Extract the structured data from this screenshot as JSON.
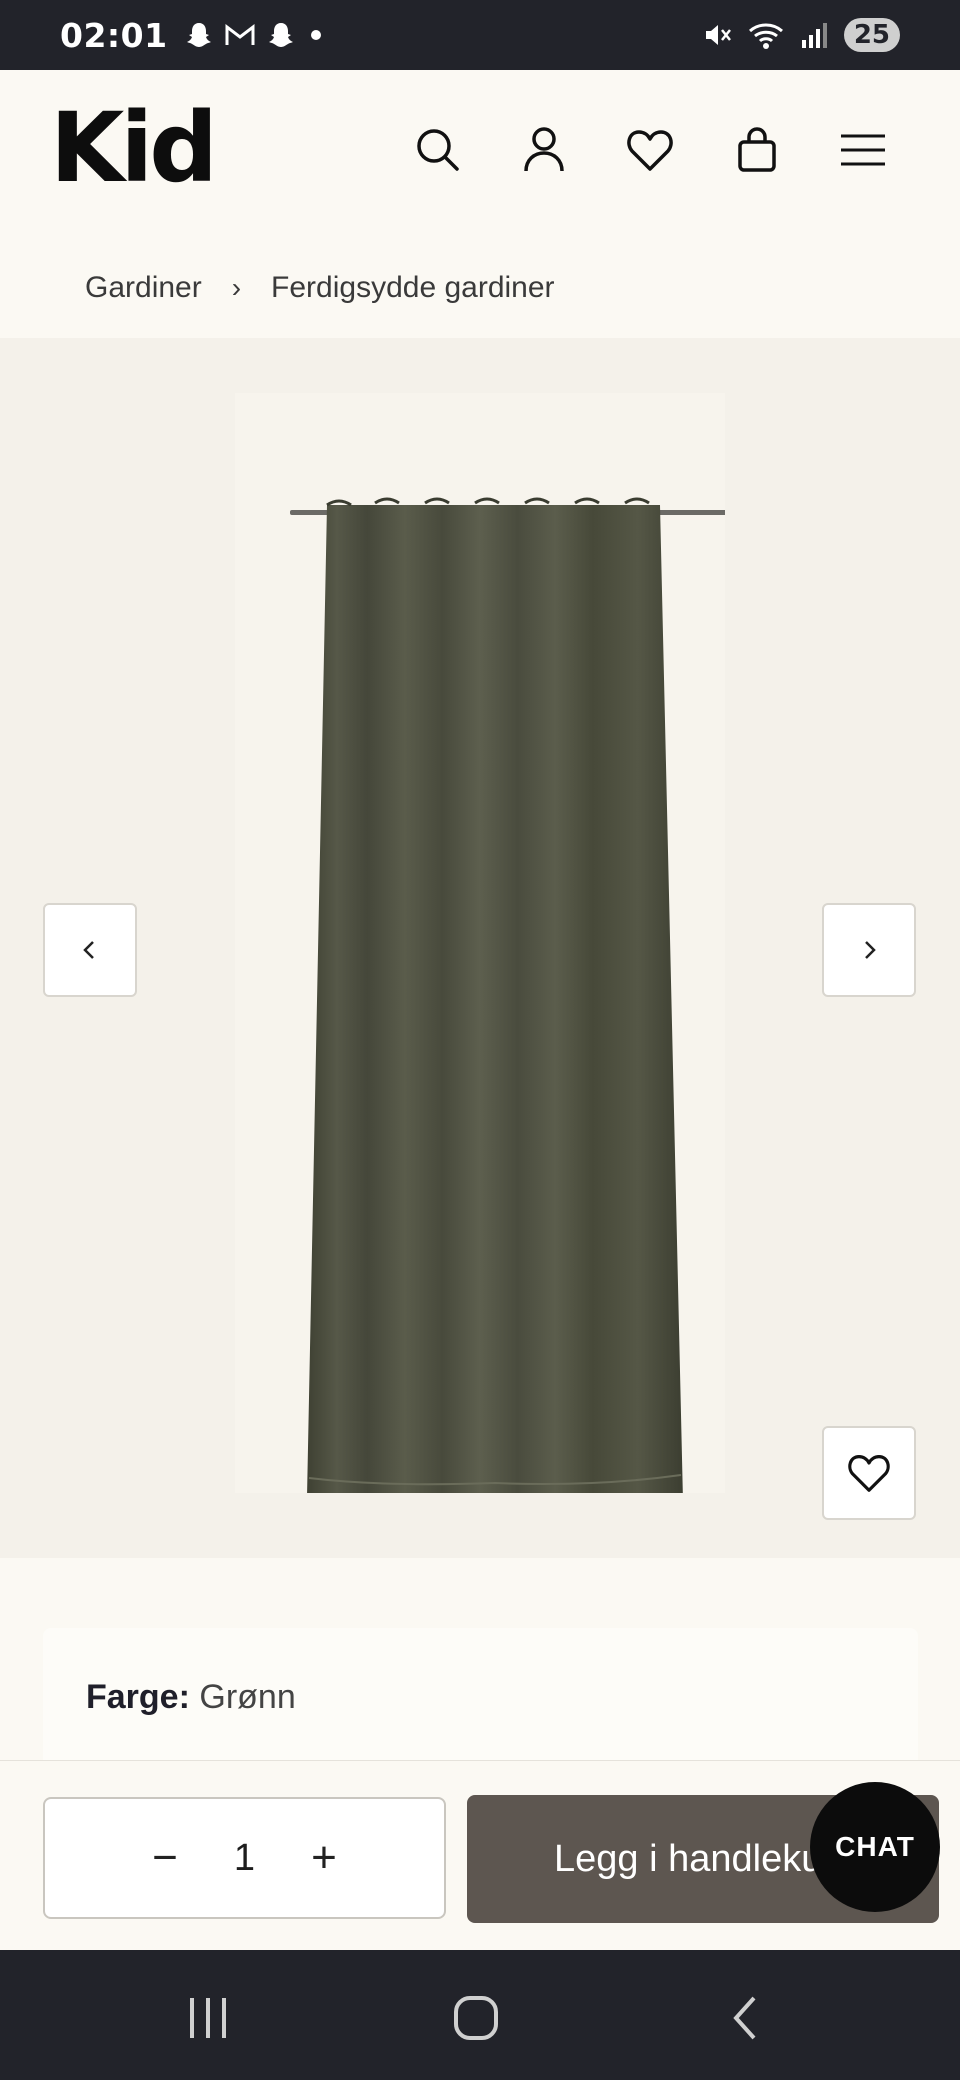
{
  "status_bar": {
    "time": "02:01",
    "battery": "25",
    "icons_left": [
      "snapchat-icon",
      "gmail-icon",
      "snapchat-icon",
      "dot-icon"
    ],
    "icons_right": [
      "mute-icon",
      "wifi-icon",
      "signal-icon"
    ]
  },
  "header": {
    "logo": "Kid",
    "icons": [
      "search-icon",
      "account-icon",
      "wishlist-icon",
      "cart-icon",
      "menu-icon"
    ]
  },
  "breadcrumb": {
    "items": [
      "Gardiner",
      "Ferdigsydde gardiner"
    ],
    "separator": "›"
  },
  "gallery": {
    "prev_icon": "chevron-left-icon",
    "next_icon": "chevron-right-icon",
    "favorite_icon": "heart-icon"
  },
  "product": {
    "color_label": "Farge:",
    "color_value": "Grønn"
  },
  "purchase": {
    "quantity": "1",
    "minus": "−",
    "plus": "+",
    "add_to_cart": "Legg i handlekurv"
  },
  "chat": {
    "label": "CHAT"
  },
  "colors": {
    "status_bg": "#22232a",
    "page_bg": "#fbf9f3",
    "gallery_bg": "#f4f1ea",
    "curtain": "#4e5040",
    "button_bg": "#5d5650"
  }
}
